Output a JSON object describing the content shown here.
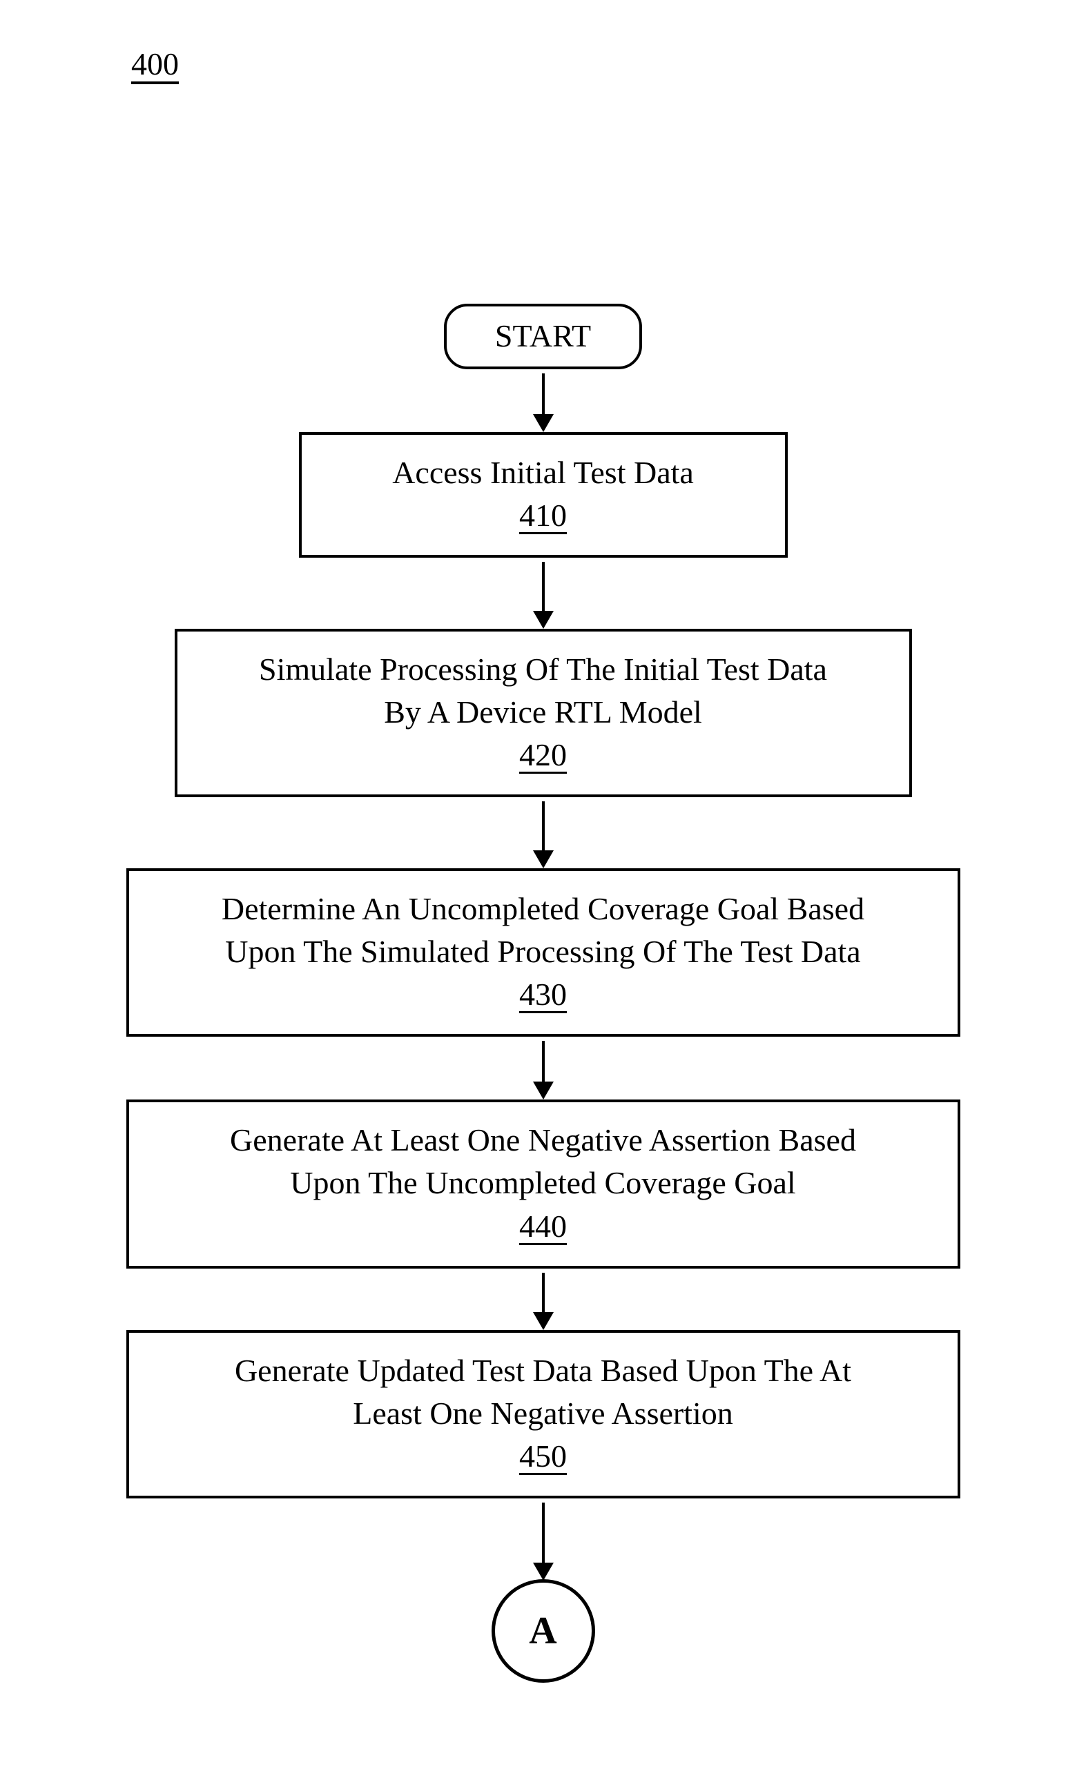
{
  "figure_number": "400",
  "start_label": "START",
  "steps": [
    {
      "text": "Access Initial Test Data",
      "ref": "410"
    },
    {
      "text_line1": "Simulate Processing Of The Initial Test Data",
      "text_line2": "By A Device RTL Model",
      "ref": "420"
    },
    {
      "text_line1": "Determine An Uncompleted Coverage Goal Based",
      "text_line2": "Upon The Simulated Processing Of The Test Data",
      "ref": "430"
    },
    {
      "text_line1": "Generate At Least One Negative Assertion Based",
      "text_line2": "Upon The Uncompleted Coverage Goal",
      "ref": "440"
    },
    {
      "text_line1": "Generate Updated Test Data Based Upon The At",
      "text_line2": "Least One Negative Assertion",
      "ref": "450"
    }
  ],
  "connector_label": "A"
}
